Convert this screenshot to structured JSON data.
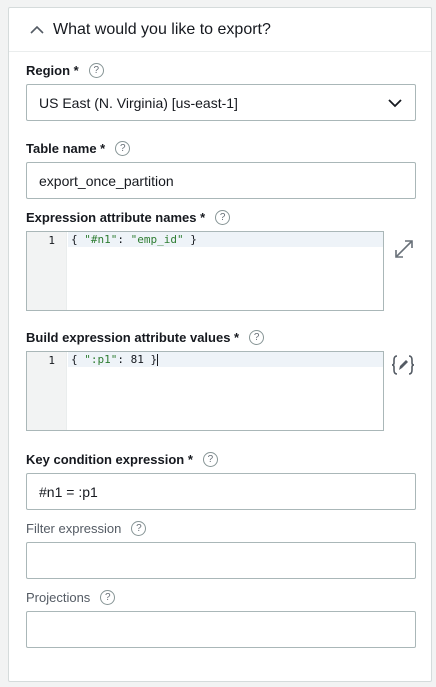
{
  "panel": {
    "title": "What would you like to export?"
  },
  "region": {
    "label": "Region *",
    "value": "US East (N. Virginia) [us-east-1]"
  },
  "table_name": {
    "label": "Table name *",
    "value": "export_once_partition"
  },
  "expr_attr_names": {
    "label": "Expression attribute names *",
    "line_number": "1",
    "code_open": "{ ",
    "code_key": "\"#n1\"",
    "code_sep": ": ",
    "code_val": "\"emp_id\"",
    "code_close": " }"
  },
  "expr_attr_values": {
    "label": "Build expression attribute values *",
    "line_number": "1",
    "code_open": "{ ",
    "code_key": "\":p1\"",
    "code_sep": ": ",
    "code_val": "81",
    "code_close": " }"
  },
  "key_condition": {
    "label": "Key condition expression *",
    "value": "#n1 = :p1"
  },
  "filter_expression": {
    "label": "Filter expression",
    "value": ""
  },
  "projections": {
    "label": "Projections",
    "value": ""
  },
  "help_glyph": "?",
  "icons": {
    "collapse": "chevron-up-icon",
    "dropdown": "chevron-down-icon",
    "expand": "expand-icon",
    "builder": "json-builder-icon",
    "help": "help-icon"
  }
}
